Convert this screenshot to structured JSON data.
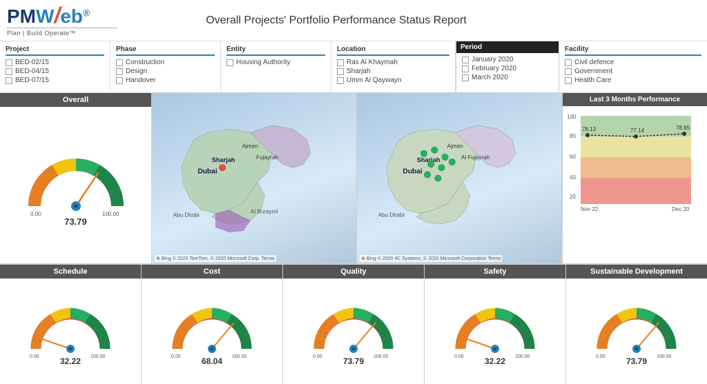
{
  "header": {
    "title": "Overall Projects' Portfolio Performance Status Report",
    "logo_pm": "PM",
    "logo_web": "Web",
    "logo_subtitle": "Plan | Build Operate™"
  },
  "period_filter": {
    "title": "Period",
    "options": [
      "January 2020",
      "February 2020",
      "March 2020"
    ]
  },
  "filters": {
    "project": {
      "title": "Project",
      "items": [
        "BED-02/15",
        "BED-04/15",
        "BED-07/15"
      ]
    },
    "phase": {
      "title": "Phase",
      "items": [
        "Construction",
        "Design",
        "Handover"
      ]
    },
    "entity": {
      "title": "Entity",
      "items": [
        "Housing Authority"
      ]
    },
    "location": {
      "title": "Location",
      "items": [
        "Ras Al Khaymah",
        "Sharjah",
        "Umm Al Qaywayn"
      ]
    },
    "facility": {
      "title": "Facility",
      "items": [
        "Civil defence",
        "Government",
        "Health Care"
      ]
    }
  },
  "gauges": {
    "overall": {
      "title": "Overall",
      "value": "73.79",
      "score": 73.79
    },
    "schedule": {
      "title": "Schedule",
      "value": "32.22",
      "score": 32.22
    },
    "cost": {
      "title": "Cost",
      "value": "68.04",
      "score": 68.04
    },
    "quality": {
      "title": "Quality",
      "value": "73.79",
      "score": 73.79
    },
    "safety": {
      "title": "Safety",
      "value": "32.22",
      "score": 32.22
    },
    "sustainable": {
      "title": "Sustainable Development",
      "value": "73.79",
      "score": 73.79
    }
  },
  "chart": {
    "title": "Last 3 Months Performance",
    "values": [
      78.13,
      77.14,
      78.95
    ],
    "labels": [
      "Nov 22",
      "",
      "Dec 20"
    ],
    "yMax": 100
  },
  "colors": {
    "red": "#e74c3c",
    "orange": "#e67e22",
    "yellow": "#f1c40f",
    "green": "#27ae60",
    "dark_green": "#1e8449",
    "blue": "#2980b9",
    "dark_header": "#555555"
  }
}
